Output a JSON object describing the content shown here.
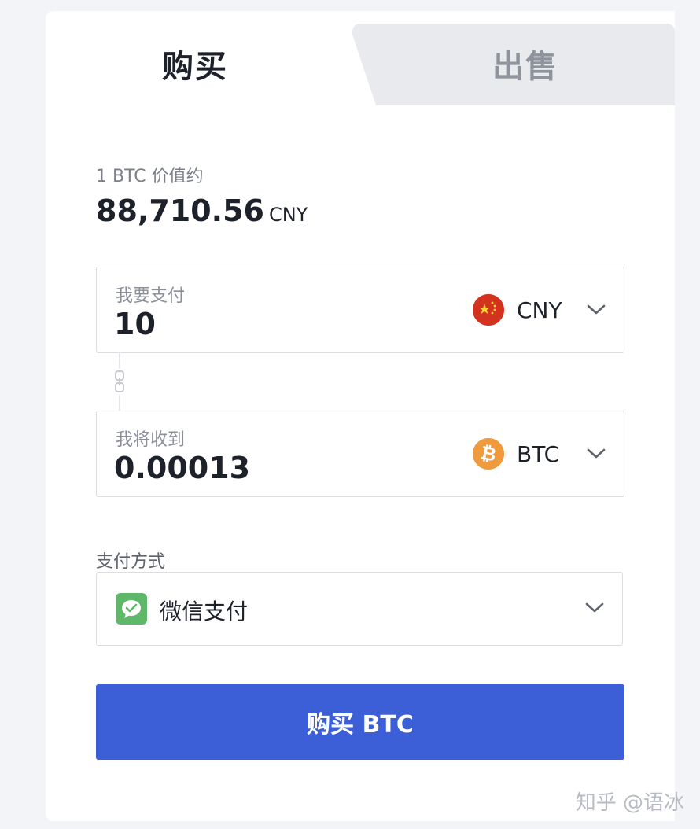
{
  "tabs": {
    "buy": "购买",
    "sell": "出售"
  },
  "rate": {
    "label": "1 BTC 价值约",
    "value": "88,710.56",
    "unit": "CNY"
  },
  "pay": {
    "label": "我要支付",
    "value": "10",
    "currency": "CNY",
    "currency_icon": "china-flag-icon"
  },
  "receive": {
    "label": "我将收到",
    "value": "0.00013",
    "currency": "BTC",
    "currency_icon": "bitcoin-icon"
  },
  "payment_method": {
    "label": "支付方式",
    "selected": "微信支付",
    "icon": "wechat-icon"
  },
  "buy_button": {
    "label": "购买 BTC"
  },
  "watermark": "知乎 @语冰",
  "colors": {
    "primary_button": "#3c5fd8",
    "btc_orange": "#ef9a3d",
    "cny_red": "#d3321e",
    "wechat_green": "#5fb86a"
  }
}
